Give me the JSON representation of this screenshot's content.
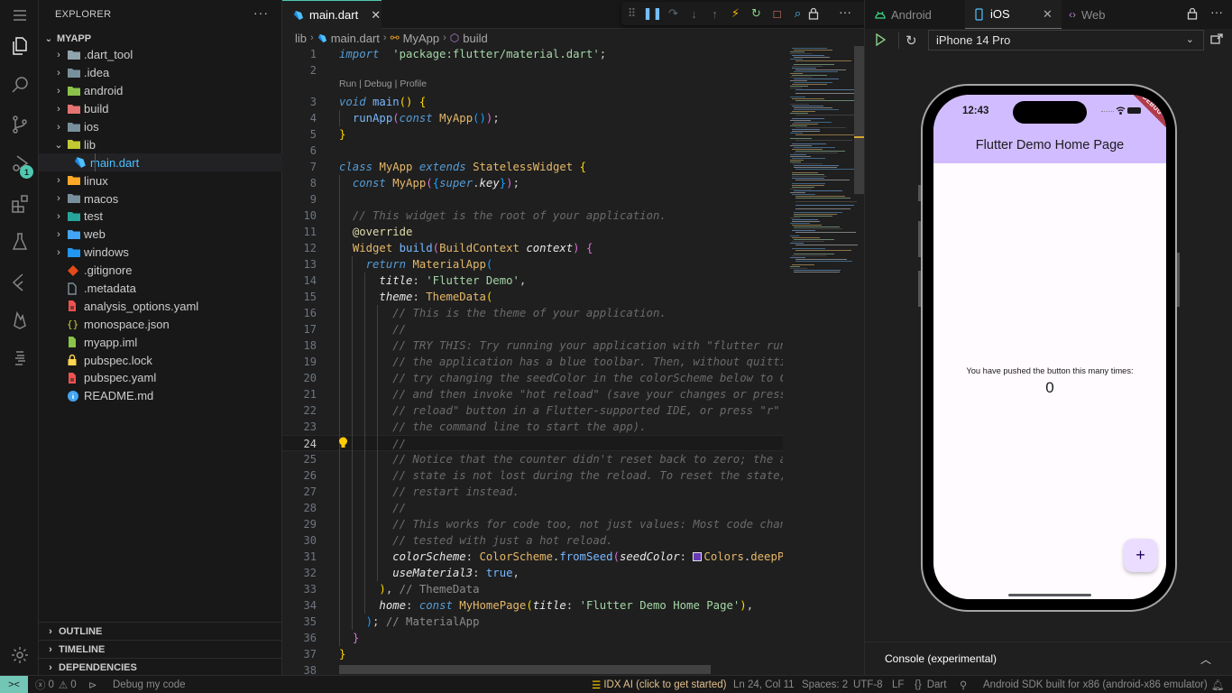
{
  "activity_bar": {
    "items": [
      {
        "name": "menu",
        "icon": "hamburger-icon"
      },
      {
        "name": "explorer",
        "icon": "files-icon",
        "active": true
      },
      {
        "name": "search",
        "icon": "search-icon"
      },
      {
        "name": "source-control",
        "icon": "source-control-icon"
      },
      {
        "name": "run-debug",
        "icon": "run-debug-icon",
        "badge": "1"
      },
      {
        "name": "extensions",
        "icon": "extensions-icon"
      },
      {
        "name": "testing",
        "icon": "flask-icon"
      },
      {
        "name": "flutter",
        "icon": "flutter-icon"
      },
      {
        "name": "firebase",
        "icon": "firebase-icon"
      },
      {
        "name": "outline-view",
        "icon": "outline-lines-icon"
      },
      {
        "name": "settings",
        "icon": "gear-icon"
      }
    ]
  },
  "sidebar": {
    "title": "EXPLORER",
    "more": "···",
    "root": "MYAPP",
    "items": [
      {
        "label": ".dart_tool",
        "type": "folder",
        "color": "#90a4ae"
      },
      {
        "label": ".idea",
        "type": "folder",
        "color": "#78909c"
      },
      {
        "label": "android",
        "type": "folder",
        "color": "#8bc34a"
      },
      {
        "label": "build",
        "type": "folder",
        "color": "#e57373"
      },
      {
        "label": "ios",
        "type": "folder",
        "color": "#78909c"
      },
      {
        "label": "lib",
        "type": "folder-open",
        "color": "#c0ca33"
      },
      {
        "label": "main.dart",
        "type": "dart",
        "color": "#4fc1ff"
      },
      {
        "label": "linux",
        "type": "folder",
        "color": "#ffa726"
      },
      {
        "label": "macos",
        "type": "folder",
        "color": "#78909c"
      },
      {
        "label": "test",
        "type": "folder",
        "color": "#26a69a"
      },
      {
        "label": "web",
        "type": "folder",
        "color": "#42a5f5"
      },
      {
        "label": "windows",
        "type": "folder",
        "color": "#2196f3"
      },
      {
        "label": ".gitignore",
        "type": "git",
        "color": "#e64a19"
      },
      {
        "label": ".metadata",
        "type": "file",
        "color": "#90a4ae"
      },
      {
        "label": "analysis_options.yaml",
        "type": "yaml",
        "color": "#ef5350"
      },
      {
        "label": "monospace.json",
        "type": "json",
        "color": "#cbcb41"
      },
      {
        "label": "myapp.iml",
        "type": "iml",
        "color": "#8bc34a"
      },
      {
        "label": "pubspec.lock",
        "type": "lock",
        "color": "#ffd54f"
      },
      {
        "label": "pubspec.yaml",
        "type": "yaml",
        "color": "#ef5350"
      },
      {
        "label": "README.md",
        "type": "info",
        "color": "#42a5f5"
      }
    ],
    "sections": [
      "OUTLINE",
      "TIMELINE",
      "DEPENDENCIES"
    ]
  },
  "editor": {
    "tab": {
      "label": "main.dart",
      "close": "✕"
    },
    "breadcrumb": [
      "lib",
      "main.dart",
      "MyApp",
      "build"
    ],
    "codelens": "Run | Debug | Profile",
    "current_line": 24,
    "line_numbers": [
      "1",
      "2",
      "3",
      "4",
      "5",
      "6",
      "7",
      "8",
      "9",
      "10",
      "11",
      "12",
      "13",
      "14",
      "15",
      "16",
      "17",
      "18",
      "19",
      "20",
      "21",
      "22",
      "23",
      "24",
      "25",
      "26",
      "27",
      "28",
      "29",
      "30",
      "31",
      "32",
      "33",
      "34",
      "35",
      "36",
      "37",
      "38"
    ],
    "lines": [
      [
        [
          "kw",
          "import"
        ],
        [
          "",
          "  "
        ],
        [
          "str",
          "'package:flutter/material.dart'"
        ],
        [
          "",
          ";"
        ]
      ],
      [],
      [
        [
          "kw",
          "void"
        ],
        [
          "",
          " "
        ],
        [
          "fn",
          "main"
        ],
        [
          "pn1",
          "()"
        ],
        [
          "",
          " "
        ],
        [
          "pn1",
          "{"
        ]
      ],
      [
        [
          "",
          "  "
        ],
        [
          "fn",
          "runApp"
        ],
        [
          "pn2",
          "("
        ],
        [
          "kw",
          "const"
        ],
        [
          "",
          " "
        ],
        [
          "cls",
          "MyApp"
        ],
        [
          "pn3",
          "()"
        ],
        [
          "pn2",
          ")"
        ],
        [
          "",
          ";"
        ]
      ],
      [
        [
          "pn1",
          "}"
        ]
      ],
      [],
      [
        [
          "kw",
          "class"
        ],
        [
          "",
          " "
        ],
        [
          "cls",
          "MyApp"
        ],
        [
          "",
          " "
        ],
        [
          "kw",
          "extends"
        ],
        [
          "",
          " "
        ],
        [
          "cls",
          "StatelessWidget"
        ],
        [
          "",
          " "
        ],
        [
          "pn1",
          "{"
        ]
      ],
      [
        [
          "",
          "  "
        ],
        [
          "kw",
          "const"
        ],
        [
          "",
          " "
        ],
        [
          "cls",
          "MyApp"
        ],
        [
          "pn2",
          "("
        ],
        [
          "pn3",
          "{"
        ],
        [
          "kw",
          "super"
        ],
        [
          "",
          "."
        ],
        [
          "prm",
          "key"
        ],
        [
          "pn3",
          "}"
        ],
        [
          "pn2",
          ")"
        ],
        [
          "",
          ";"
        ]
      ],
      [],
      [
        [
          "",
          "  "
        ],
        [
          "cm",
          "// This widget is the root of your application."
        ]
      ],
      [
        [
          "",
          "  "
        ],
        [
          "ann",
          "@override"
        ]
      ],
      [
        [
          "",
          "  "
        ],
        [
          "cls",
          "Widget"
        ],
        [
          "",
          " "
        ],
        [
          "fn",
          "build"
        ],
        [
          "pn2",
          "("
        ],
        [
          "cls",
          "BuildContext"
        ],
        [
          "",
          " "
        ],
        [
          "prm",
          "context"
        ],
        [
          "pn2",
          ")"
        ],
        [
          "",
          " "
        ],
        [
          "pn2",
          "{"
        ]
      ],
      [
        [
          "",
          "    "
        ],
        [
          "kw",
          "return"
        ],
        [
          "",
          " "
        ],
        [
          "cls",
          "MaterialApp"
        ],
        [
          "pn3",
          "("
        ]
      ],
      [
        [
          "",
          "      "
        ],
        [
          "prm",
          "title"
        ],
        [
          "",
          ": "
        ],
        [
          "str",
          "'Flutter Demo'"
        ],
        [
          "",
          ","
        ]
      ],
      [
        [
          "",
          "      "
        ],
        [
          "prm",
          "theme"
        ],
        [
          "",
          ": "
        ],
        [
          "cls",
          "ThemeData"
        ],
        [
          "pn1",
          "("
        ]
      ],
      [
        [
          "",
          "        "
        ],
        [
          "cm",
          "// This is the theme of your application."
        ]
      ],
      [
        [
          "",
          "        "
        ],
        [
          "cm",
          "//"
        ]
      ],
      [
        [
          "",
          "        "
        ],
        [
          "cm",
          "// TRY THIS: Try running your application with \"flutter run\". You'll see"
        ]
      ],
      [
        [
          "",
          "        "
        ],
        [
          "cm",
          "// the application has a blue toolbar. Then, without quitting the app,"
        ]
      ],
      [
        [
          "",
          "        "
        ],
        [
          "cm",
          "// try changing the seedColor in the colorScheme below to Colors.green"
        ]
      ],
      [
        [
          "",
          "        "
        ],
        [
          "cm",
          "// and then invoke \"hot reload\" (save your changes or press the \"hot"
        ]
      ],
      [
        [
          "",
          "        "
        ],
        [
          "cm",
          "// reload\" button in a Flutter-supported IDE, or press \"r\" if you used"
        ]
      ],
      [
        [
          "",
          "        "
        ],
        [
          "cm",
          "// the command line to start the app)."
        ]
      ],
      [
        [
          "",
          "        "
        ],
        [
          "cm",
          "//"
        ]
      ],
      [
        [
          "",
          "        "
        ],
        [
          "cm",
          "// Notice that the counter didn't reset back to zero; the application"
        ]
      ],
      [
        [
          "",
          "        "
        ],
        [
          "cm",
          "// state is not lost during the reload. To reset the state, use hot"
        ]
      ],
      [
        [
          "",
          "        "
        ],
        [
          "cm",
          "// restart instead."
        ]
      ],
      [
        [
          "",
          "        "
        ],
        [
          "cm",
          "//"
        ]
      ],
      [
        [
          "",
          "        "
        ],
        [
          "cm",
          "// This works for code too, not just values: Most code changes can be"
        ]
      ],
      [
        [
          "",
          "        "
        ],
        [
          "cm",
          "// tested with just a hot reload."
        ]
      ],
      [
        [
          "",
          "        "
        ],
        [
          "prm",
          "colorScheme"
        ],
        [
          "",
          ": "
        ],
        [
          "cls",
          "ColorScheme"
        ],
        [
          "",
          "."
        ],
        [
          "fn",
          "fromSeed"
        ],
        [
          "pn2",
          "("
        ],
        [
          "prm",
          "seedColor"
        ],
        [
          "",
          ": "
        ],
        [
          "swatch",
          ""
        ],
        [
          "cls",
          "Colors"
        ],
        [
          "",
          "."
        ],
        [
          "cls",
          "deepPurple"
        ],
        [
          "pn2",
          ")"
        ],
        [
          "",
          ","
        ]
      ],
      [
        [
          "",
          "        "
        ],
        [
          "prm",
          "useMaterial3"
        ],
        [
          "",
          ": "
        ],
        [
          "lit",
          "true"
        ],
        [
          "",
          ","
        ]
      ],
      [
        [
          "",
          "      "
        ],
        [
          "pn1",
          ")"
        ],
        [
          "",
          ", "
        ],
        [
          "cm2",
          "// ThemeData"
        ]
      ],
      [
        [
          "",
          "      "
        ],
        [
          "prm",
          "home"
        ],
        [
          "",
          ": "
        ],
        [
          "kw",
          "const"
        ],
        [
          "",
          " "
        ],
        [
          "cls",
          "MyHomePage"
        ],
        [
          "pn1",
          "("
        ],
        [
          "prm",
          "title"
        ],
        [
          "",
          ": "
        ],
        [
          "str",
          "'Flutter Demo Home Page'"
        ],
        [
          "pn1",
          ")"
        ],
        [
          "",
          ","
        ]
      ],
      [
        [
          "",
          "    "
        ],
        [
          "pn3",
          ")"
        ],
        [
          "",
          ";"
        ],
        [
          "",
          " "
        ],
        [
          "cm2",
          "// MaterialApp"
        ]
      ],
      [
        [
          "",
          "  "
        ],
        [
          "pn2",
          "}"
        ]
      ],
      [
        [
          "pn1",
          "}"
        ]
      ],
      []
    ]
  },
  "debug_toolbar": {
    "buttons": [
      {
        "name": "drag-handle",
        "glyph": "⠿",
        "color": "#6a6a6a"
      },
      {
        "name": "pause",
        "glyph": "❚❚",
        "color": "#75beff"
      },
      {
        "name": "step-over",
        "glyph": "↷",
        "color": "#5a6a7a"
      },
      {
        "name": "step-into",
        "glyph": "↓",
        "color": "#5a6a7a"
      },
      {
        "name": "step-out",
        "glyph": "↑",
        "color": "#5a6a7a"
      },
      {
        "name": "hot-reload",
        "glyph": "⚡",
        "color": "#ffb300"
      },
      {
        "name": "hot-restart",
        "glyph": "↻",
        "color": "#89d185"
      },
      {
        "name": "stop",
        "glyph": "□",
        "color": "#f48771"
      },
      {
        "name": "inspect-widget",
        "glyph": "⌕",
        "color": "#4fc1ff"
      }
    ]
  },
  "preview_panel": {
    "tabs": [
      {
        "label": "Android",
        "icon": "android-icon",
        "icon_color": "#3ddc84"
      },
      {
        "label": "iOS",
        "icon": "phone-icon",
        "icon_color": "#4fc1ff",
        "active": true,
        "close": "✕"
      },
      {
        "label": "Web",
        "icon": "code-brackets-icon",
        "icon_color": "#b180d7"
      }
    ],
    "device": "iPhone 14 Pro",
    "console_label": "Console (experimental)"
  },
  "phone_app": {
    "status_time": "12:43",
    "debug_banner": "DEBUG",
    "appbar_title": "Flutter Demo Home Page",
    "counter_label": "You have pushed the button this many times:",
    "counter_value": "0",
    "fab_label": "+",
    "appbar_color": "#d1bcff",
    "fab_color": "#eaddff"
  },
  "status_bar": {
    "remote_icon": "remote-icon",
    "errors": "0",
    "warnings": "0",
    "debug_label": "Debug my code",
    "idx_ai": "IDX AI (click to get started)",
    "position": "Ln 24, Col 11",
    "spaces": "Spaces: 2",
    "encoding": "UTF-8",
    "eol": "LF",
    "language": "Dart",
    "device": "Android SDK built for x86 (android-x86 emulator)"
  }
}
